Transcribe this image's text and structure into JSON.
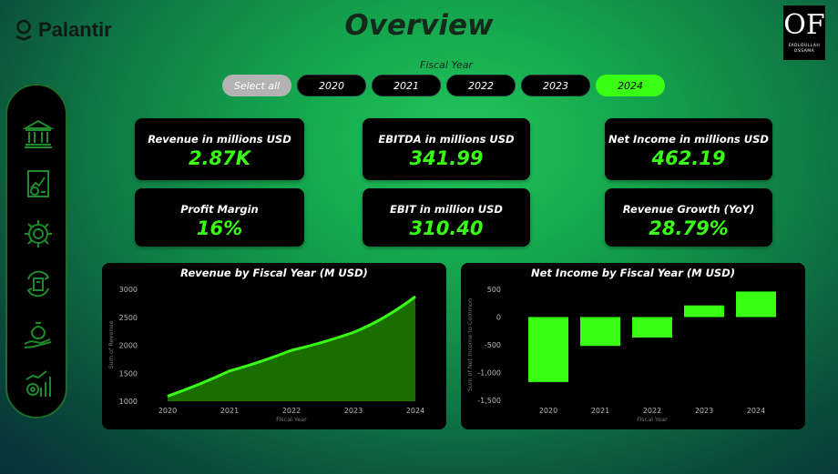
{
  "header": {
    "brand_name": "Palantir",
    "title": "Overview",
    "author_monogram": "OF",
    "author_name": "FADLOULLAH OSSAMA"
  },
  "slicer": {
    "title": "Fiscal Year",
    "options": [
      "Select all",
      "2020",
      "2021",
      "2022",
      "2023",
      "2024"
    ],
    "selected": "2024"
  },
  "sidebar": {
    "items": [
      "bank-icon",
      "financial-report-icon",
      "money-gear-icon",
      "money-cycle-icon",
      "money-hand-icon",
      "growth-chart-icon"
    ]
  },
  "kpis": [
    {
      "label": "Revenue in millions USD",
      "value": "2.87K"
    },
    {
      "label": "EBITDA in millions USD",
      "value": "341.99"
    },
    {
      "label": "Net Income in millions USD",
      "value": "462.19"
    },
    {
      "label": "Profit Margin",
      "value": "16%"
    },
    {
      "label": "EBIT in million USD",
      "value": "310.40"
    },
    {
      "label": "Revenue Growth (YoY)",
      "value": "28.79%"
    }
  ],
  "colors": {
    "accent": "#39ff14",
    "area_fill": "#1a6e00",
    "card_bg": "#000000"
  },
  "chart_data": [
    {
      "type": "area",
      "title": "Revenue by Fiscal Year (M USD)",
      "xlabel": "Fiscal Year",
      "ylabel": "Sum of Revenue",
      "categories": [
        "2020",
        "2021",
        "2022",
        "2023",
        "2024"
      ],
      "values": [
        1090,
        1540,
        1910,
        2230,
        2870
      ],
      "yticks": [
        "3000",
        "2500",
        "2000",
        "1500",
        "1000"
      ],
      "ylim": [
        1000,
        3000
      ],
      "grid": false
    },
    {
      "type": "bar",
      "title": "Net Income by Fiscal Year (M USD)",
      "xlabel": "Fiscal Year",
      "ylabel": "Sum of Net Income to Common",
      "categories": [
        "2020",
        "2021",
        "2022",
        "2023",
        "2024"
      ],
      "values": [
        -1170,
        -520,
        -370,
        210,
        460
      ],
      "yticks": [
        "500",
        "0",
        "-500",
        "-1,000",
        "-1,500"
      ],
      "ylim": [
        -1500,
        500
      ],
      "grid": false
    }
  ]
}
